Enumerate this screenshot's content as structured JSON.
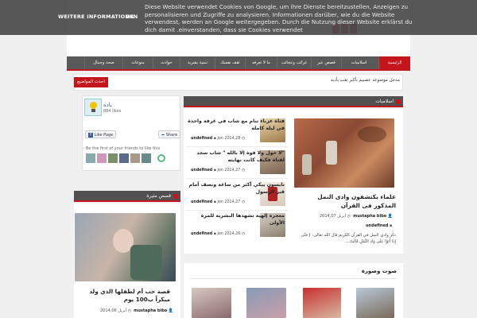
{
  "cookie_bar": {
    "more_info": "WEITERE INFORMATIONEN",
    "ok": "OK",
    "message": "Diese Website verwendet Cookies von Google, um ihre Dienste bereitzustellen, Anzeigen zu personalisieren und Zugriffe zu analysieren. Informationen darüber, wie du die Website verwendest, werden an Google weitergegeben. Durch die Nutzung dieser Website erklärst du dich damit .einverstanden, dass sie Cookies verwendet"
  },
  "nav": {
    "items": [
      "الرئيسية",
      "اسلاميات",
      "قصص عبر",
      "غرائب وعجائب",
      "ما لا تعرفه",
      "ثقف نفسك",
      "تنمية بشرية",
      "حوادث",
      "منوعات",
      "صحة وجمال"
    ]
  },
  "ticker": {
    "label": "احدث المواضيع",
    "text": "مدخل موضوعه عصبيم بأكبر تقب بأدبه"
  },
  "islamic": {
    "heading": "اسلاميات",
    "featured": {
      "title": "علماء يكتشفون وادى النمل المذكور فى القرآن",
      "author": "mustapha bibo",
      "date": "أبريل 2014,07",
      "category": "undefined",
      "excerpt": "ذكر وادي النمل في القرآن الكريم قال الله تعالى: {حَتَّى إِذَا أَتَوْا عَلَى وَادِ النَّمْلِ قَالَتْ..."
    },
    "items": [
      {
        "title": "فتاة عزباء تنام مع شاب في غرفة واحدة في ليلة كاملة",
        "category": "undefined",
        "date": "Jan 2014,28"
      },
      {
        "title": "\"لا حول ولا قوة إلا بالله \" شاب سجد لفتاة فكيف كانت نهايته",
        "category": "undefined",
        "date": "Jan 2014,27"
      },
      {
        "title": "تايسون يبكي أكثر من ساعة ونصف أمام قبر الرسول",
        "category": "undefined",
        "date": "Jan 2014,27"
      },
      {
        "title": "معجزة إلهية تشهدها البشرية للمرة الأولى",
        "category": "undefined",
        "date": "Jan 2014,26"
      }
    ]
  },
  "facebook": {
    "page_name": "ياده",
    "likes": "884 likes",
    "like_button": "Like Page",
    "share_button": "Share",
    "friends_text": "Be the first of your friends to like this"
  },
  "stories": {
    "heading": "قصص مثيرة",
    "title": "قصة حب أم لطفلها الذي ولد مبكراً ب100 يوم",
    "date": "أبريل 2014,06",
    "author": "mustapha bibo"
  },
  "photos": {
    "heading": "صوت وصورة"
  },
  "colors": {
    "accent": "#c4161c",
    "nav_bg": "#595959",
    "cookie_bg": "#4b4b4b"
  }
}
